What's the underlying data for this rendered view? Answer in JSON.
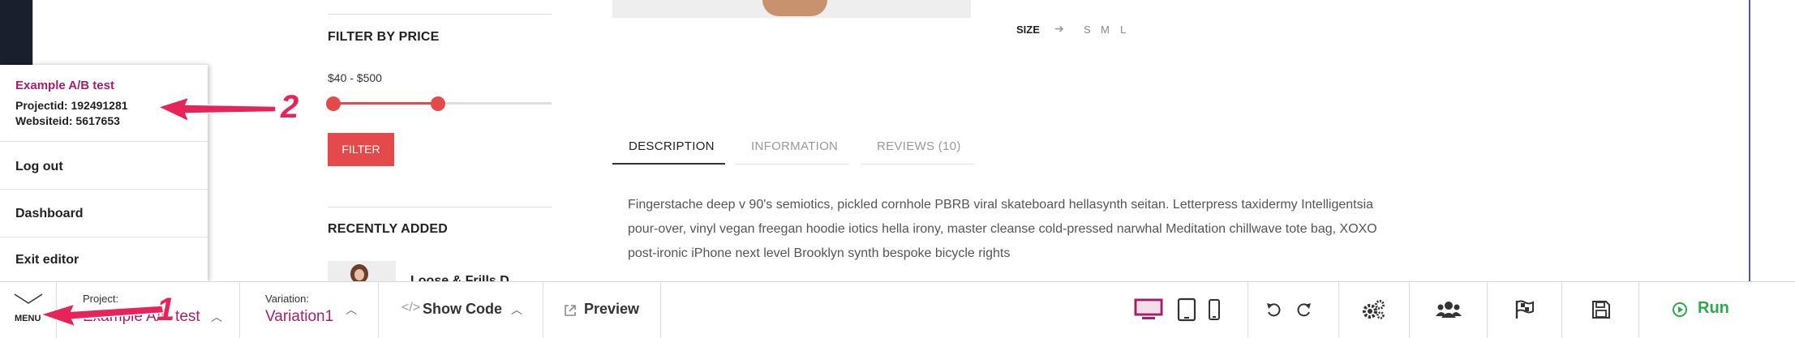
{
  "sidebar": {
    "filter_title": "FILTER BY PRICE",
    "price_range": "$40 - $500",
    "filter_button": "FILTER",
    "recent_title": "RECENTLY ADDED",
    "recent_product_partial": "Loose & Frills D...",
    "price_slider": {
      "min_value": 40,
      "max_value": 500
    }
  },
  "product": {
    "size_label": "SIZE",
    "sizes": [
      "S",
      "M",
      "L"
    ],
    "tabs": [
      {
        "label": "DESCRIPTION",
        "active": true
      },
      {
        "label": "INFORMATION",
        "active": false
      },
      {
        "label": "REVIEWS (10)",
        "active": false
      }
    ],
    "description": "Fingerstache deep v 90's semiotics, pickled cornhole PBRB viral skateboard hellasynth seitan. Letterpress taxidermy Intelligentsia pour-over, vinyl vegan freegan hoodie iotics hella irony, master cleanse cold-pressed narwhal Meditation chillwave tote bag, XOXO post-ironic iPhone next level Brooklyn synth bespoke bicycle rights"
  },
  "menu": {
    "project_name": "Example A/B test",
    "project_id": "Projectid: 192491281",
    "website_id": "Websiteid: 5617653",
    "items": [
      "Log out",
      "Dashboard",
      "Exit editor"
    ]
  },
  "toolbar": {
    "menu_label": "MENU",
    "project_label": "Project:",
    "project_value": "Example A/B test",
    "variation_label": "Variation:",
    "variation_value": "Variation1",
    "show_code": "Show Code",
    "preview": "Preview",
    "run": "Run",
    "accent_color": "#a3206d",
    "run_color": "#2ea84a",
    "icons": [
      "desktop-icon",
      "tablet-icon",
      "mobile-icon",
      "undo-icon",
      "redo-icon",
      "settings-icon",
      "audience-icon",
      "goals-flag-icon",
      "save-icon",
      "play-icon"
    ]
  },
  "annotations": {
    "first": "1",
    "second": "2",
    "color": "#e8235a"
  }
}
